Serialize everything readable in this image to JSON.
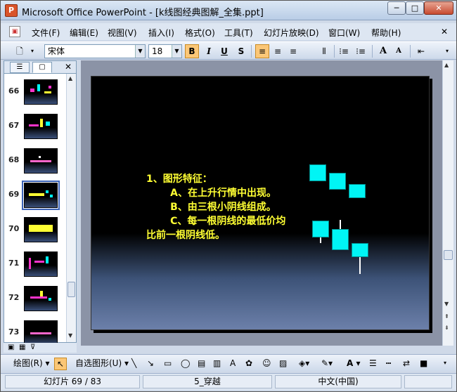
{
  "window": {
    "title": "Microsoft Office PowerPoint - [k线图经典图解_全集.ppt]",
    "min_label": "─",
    "max_label": "□",
    "close_label": "✕"
  },
  "menubar": {
    "items": [
      "文件(F)",
      "编辑(E)",
      "视图(V)",
      "插入(I)",
      "格式(O)",
      "工具(T)",
      "幻灯片放映(D)",
      "窗口(W)",
      "帮助(H)"
    ],
    "close_label": "✕"
  },
  "toolbar": {
    "font_name": "宋体",
    "font_size": "18",
    "bold_label": "B",
    "italic_label": "I",
    "underline_label": "U",
    "shadow_label": "S",
    "grow_label": "A",
    "shrink_label": "A"
  },
  "left_pane": {
    "close_label": "✕",
    "thumbnails": [
      {
        "num": "66",
        "selected": false
      },
      {
        "num": "67",
        "selected": false
      },
      {
        "num": "68",
        "selected": false
      },
      {
        "num": "69",
        "selected": true
      },
      {
        "num": "70",
        "selected": false
      },
      {
        "num": "71",
        "selected": false
      },
      {
        "num": "72",
        "selected": false
      },
      {
        "num": "73",
        "selected": false
      }
    ]
  },
  "slide": {
    "text": "1、图形特征：\n       A、在上升行情中出现。\n       B、由三根小阴线组成。\n       C、每一根阴线的最低价均\n比前一根阴线低。",
    "text_color": "#ffff33",
    "candle_color": "#00f5f5"
  },
  "drawbar": {
    "draw_label": "绘图(R)",
    "autoshape_label": "自选图形(U)",
    "font_color_label": "A"
  },
  "status": {
    "slide_info": "幻灯片 69 / 83",
    "design": "5_穿越",
    "language": "中文(中国)"
  }
}
